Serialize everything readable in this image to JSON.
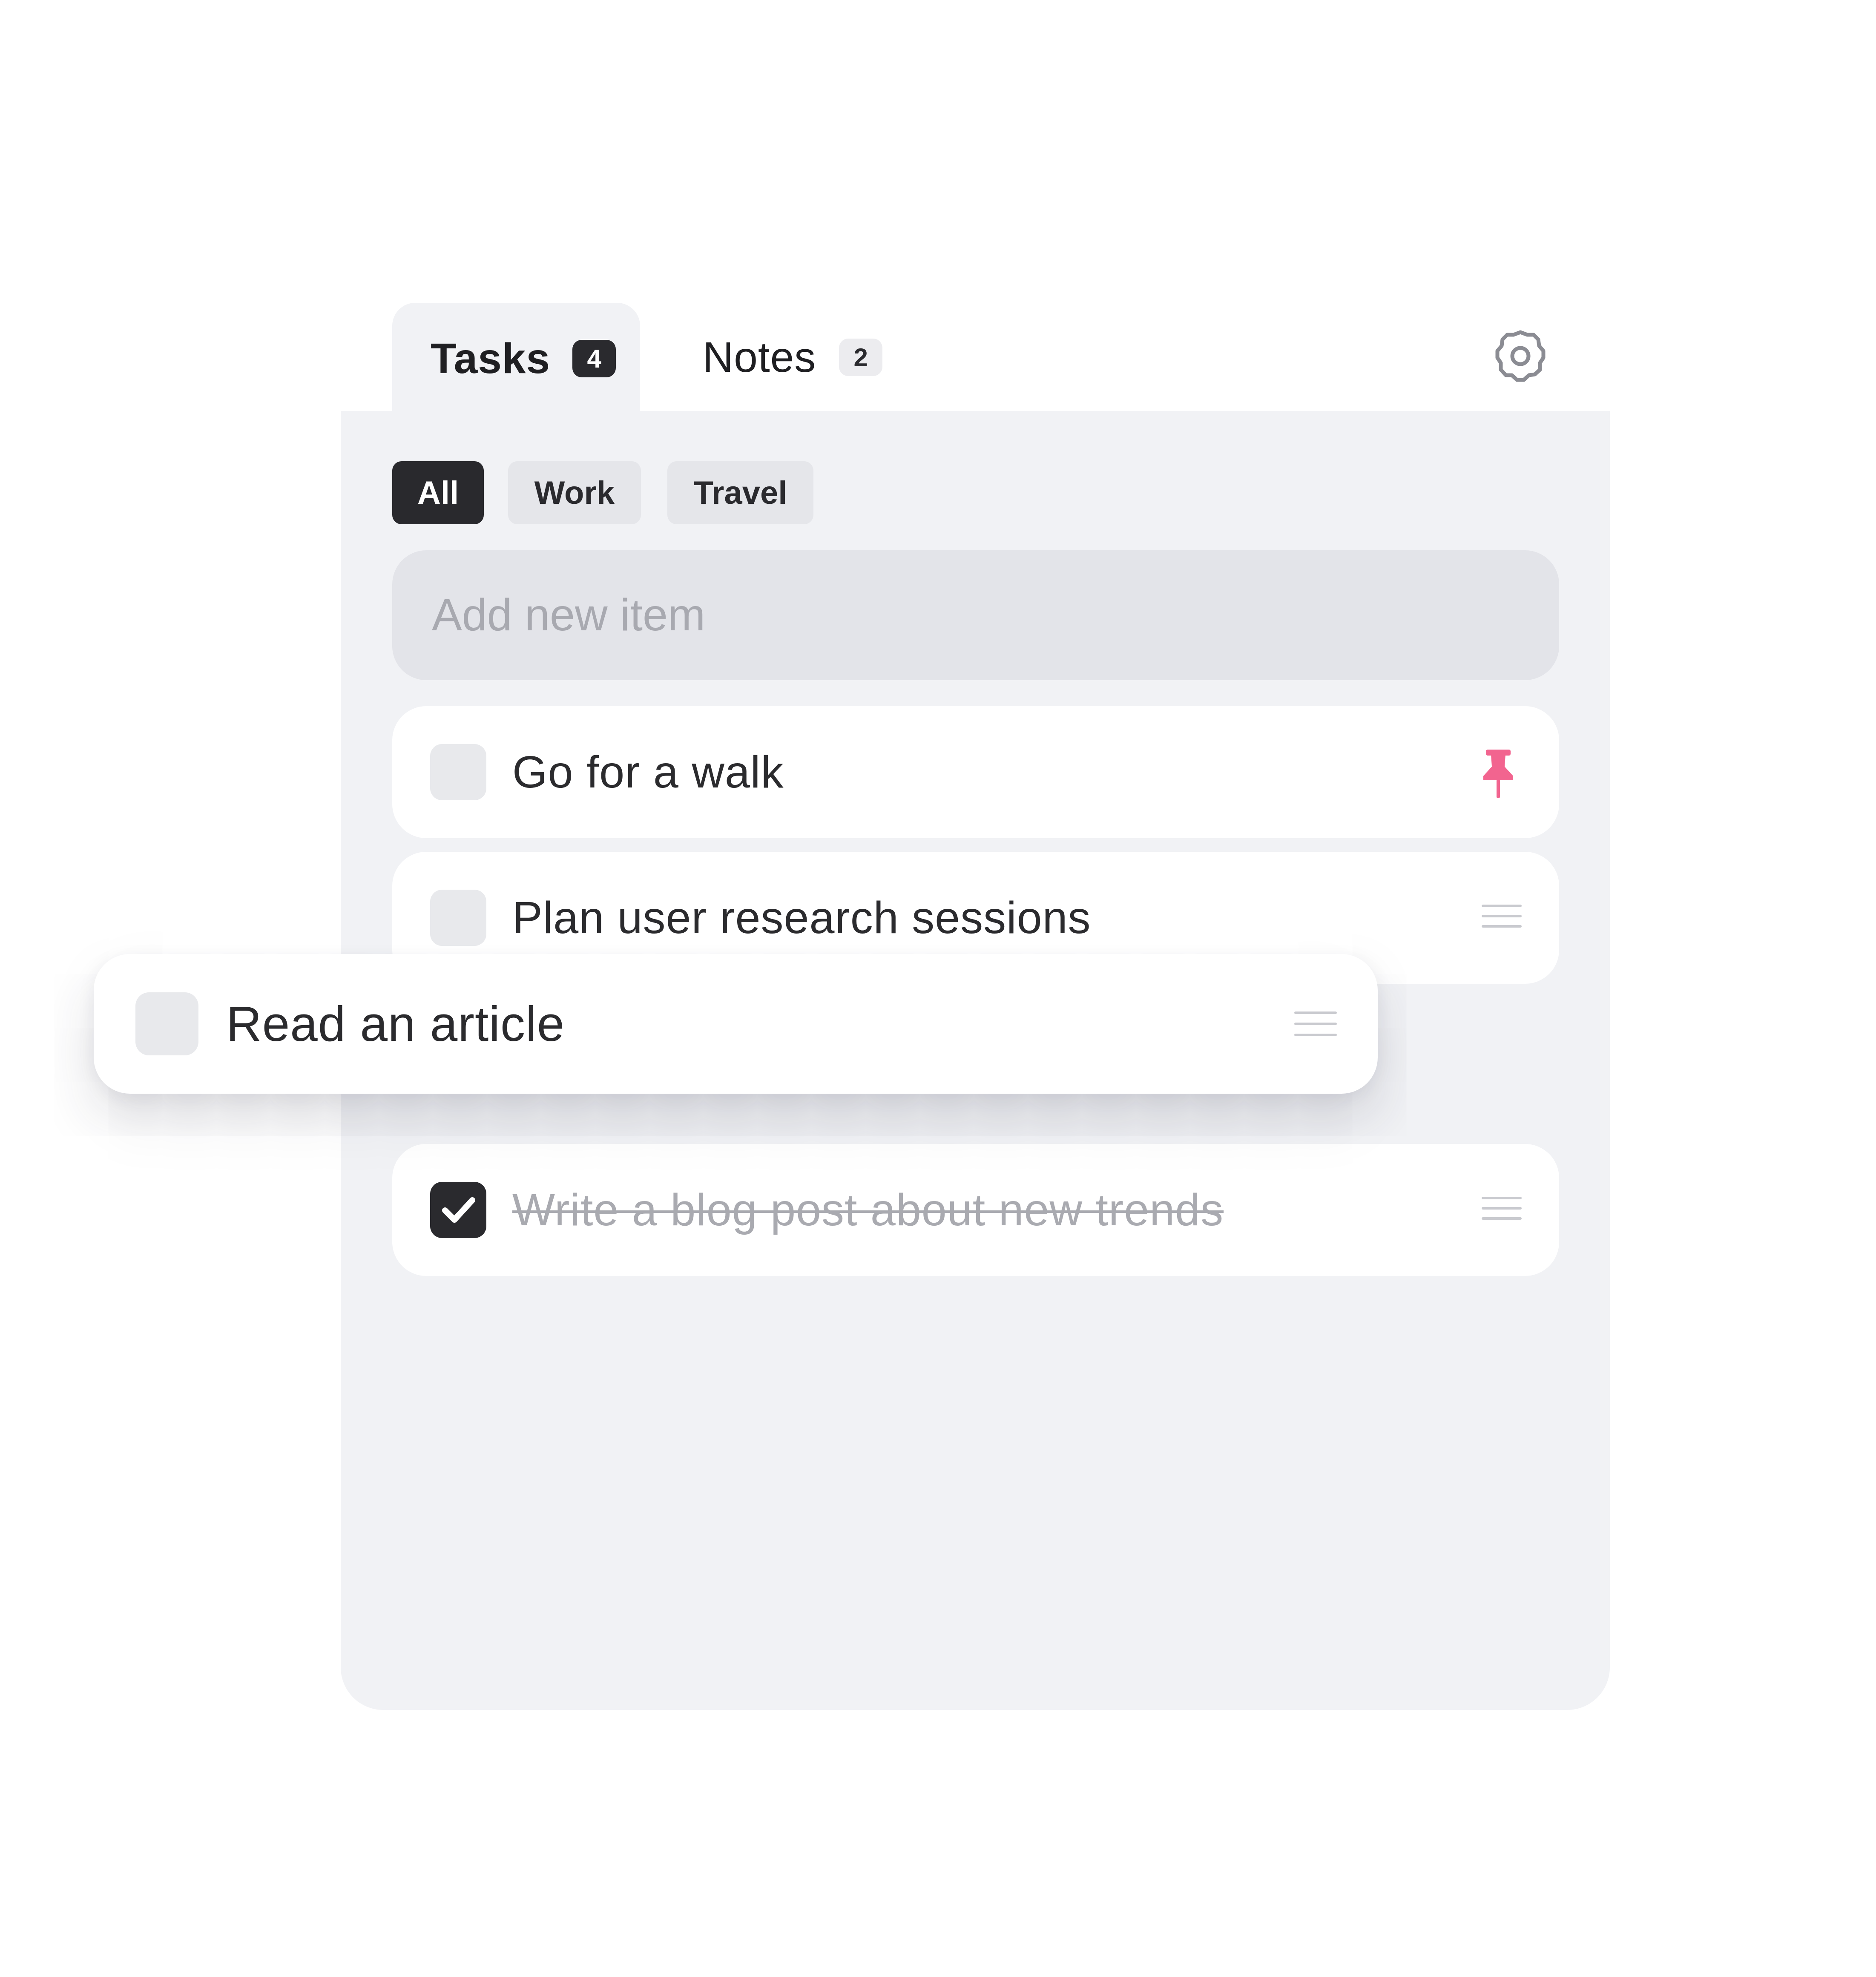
{
  "tabs": [
    {
      "label": "Tasks",
      "count": "4",
      "active": true
    },
    {
      "label": "Notes",
      "count": "2",
      "active": false
    }
  ],
  "filters": [
    {
      "label": "All",
      "active": true
    },
    {
      "label": "Work",
      "active": false
    },
    {
      "label": "Travel",
      "active": false
    }
  ],
  "add_input": {
    "placeholder": "Add new item",
    "value": ""
  },
  "tasks": [
    {
      "text": "Go for a walk",
      "checked": false,
      "pinned": true
    },
    {
      "text": "Plan user research sessions",
      "checked": false,
      "pinned": false
    },
    {
      "text": "Read an article",
      "checked": false,
      "pinned": false,
      "dragging": true
    },
    {
      "text": "Write a blog post about new trends",
      "checked": true,
      "pinned": false
    }
  ],
  "icons": {
    "settings": "gear-icon",
    "pin": "pin-icon",
    "drag": "drag-handle-icon",
    "check": "check-icon"
  },
  "colors": {
    "accent_dark": "#29292d",
    "pin": "#f2648f",
    "panel_bg": "#f1f2f5",
    "muted_text": "#a9aab0"
  }
}
